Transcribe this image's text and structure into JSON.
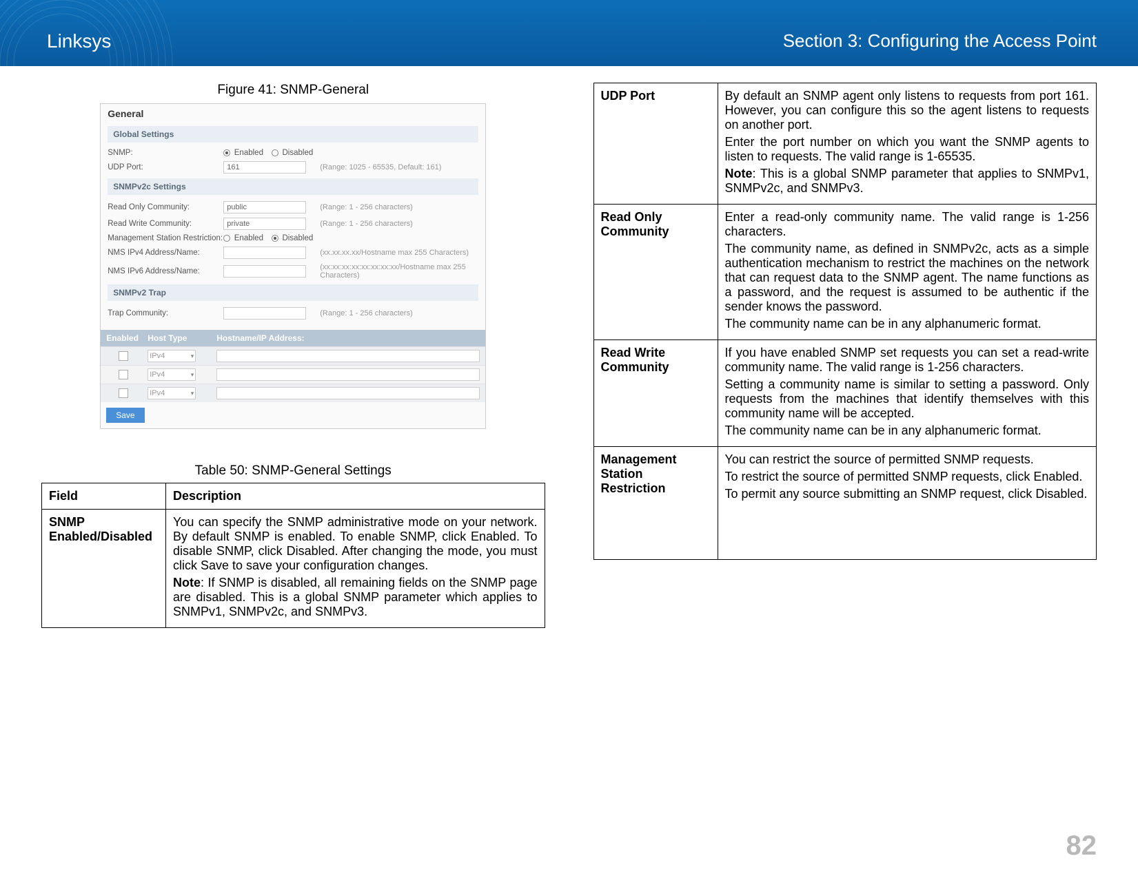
{
  "header": {
    "brand": "Linksys",
    "section": "Section 3:  Configuring the Access Point"
  },
  "figure": {
    "caption": "Figure 41: SNMP-General",
    "title": "General",
    "globalSettingsHeader": "Global Settings",
    "snmpLabel": "SNMP:",
    "enabled": "Enabled",
    "disabled": "Disabled",
    "udpPortLabel": "UDP Port:",
    "udpPortValue": "161",
    "udpPortHint": "(Range: 1025 - 65535, Default: 161)",
    "snmpv2cHeader": "SNMPv2c Settings",
    "roCommLabel": "Read Only Community:",
    "roCommValue": "public",
    "roCommHint": "(Range: 1 - 256 characters)",
    "rwCommLabel": "Read Write Community:",
    "rwCommValue": "private",
    "rwCommHint": "(Range: 1 - 256 characters)",
    "mgmtRestrictLabel": "Management Station Restriction:",
    "ipv4Label": "NMS IPv4 Address/Name:",
    "ipv4Hint": "(xx.xx.xx.xx/Hostname max 255 Characters)",
    "ipv6Label": "NMS IPv6 Address/Name:",
    "ipv6Hint": "(xx:xx:xx:xx:xx:xx:xx:xx/Hostname max 255 Characters)",
    "trapHeader": "SNMPv2 Trap",
    "trapCommLabel": "Trap Community:",
    "trapCommHint": "(Range: 1 - 256 characters)",
    "thEnabled": "Enabled",
    "thHostType": "Host Type",
    "thHostname": "Hostname/IP Address:",
    "hostTypeOptions": [
      "IPv4",
      "IPv4",
      "IPv4"
    ],
    "saveLabel": "Save"
  },
  "tableLeft": {
    "caption": "Table 50: SNMP-General Settings",
    "fieldHeader": "Field",
    "descHeader": "Description",
    "row1": {
      "field": "SNMP Enabled/Disabled",
      "p1": "You can specify the SNMP administrative mode on your network. By default SNMP is enabled. To enable SNMP, click Enabled. To disable SNMP, click Disabled. After changing the mode, you must click Save to save your configuration changes.",
      "noteLabel": "Note",
      "noteText": ":    If SNMP is disabled, all remaining fields on the SNMP page are disabled. This is a global SNMP parameter which applies to SNMPv1, SNMPv2c, and SNMPv3."
    }
  },
  "tableRight": {
    "rows": [
      {
        "field": "UDP Port",
        "p1": "By default an SNMP agent only listens to requests from port 161. However, you can configure this so the agent listens to requests on another port.",
        "p2": "Enter the port number on which you want the SNMP agents to listen to requests. The valid range is 1-65535.",
        "noteLabel": "Note",
        "noteText": ":    This is a global SNMP parameter that applies to SNMPv1, SNMPv2c, and SNMPv3."
      },
      {
        "field": "Read Only Community",
        "p1": "Enter a read-only community name. The valid range is 1-256 characters.",
        "p2": "The community name, as defined in SNMPv2c, acts as a simple authentication mechanism to restrict the machines on the network that can request data to the SNMP agent. The name functions as a password, and the request is assumed to be authentic if the sender knows the password.",
        "p3": "The community name can be in any alphanumeric format."
      },
      {
        "field": "Read Write Community",
        "p1": "If you have enabled SNMP set requests you can set a read-write community name. The valid range is 1-256 characters.",
        "p2": "Setting a community name is similar to setting a password. Only requests from the machines that identify themselves with this community name will be accepted.",
        "p3": "The community name can be in any alphanumeric format."
      },
      {
        "field": "Management Station Restriction",
        "p1": "You can restrict the source of permitted SNMP requests.",
        "p2": "To restrict the source of permitted SNMP requests, click Enabled.",
        "p3": "To permit any source submitting an SNMP request, click Disabled."
      }
    ]
  },
  "pageNumber": "82"
}
